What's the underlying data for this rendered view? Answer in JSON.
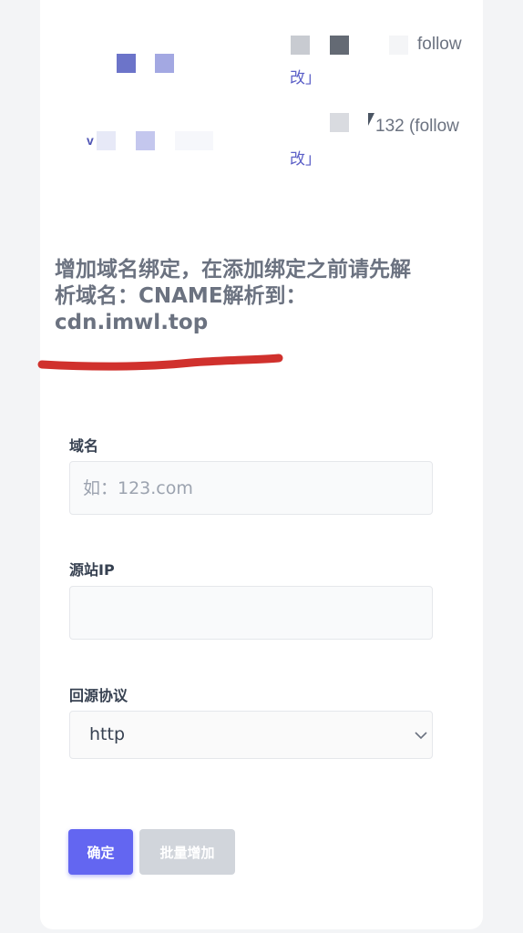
{
  "list": {
    "rows": [
      {
        "follow_text": "follow",
        "suffix_text": "改」"
      },
      {
        "follow_text": "132 (follow",
        "prefix_text": "v",
        "suffix_text": "改」"
      }
    ]
  },
  "form": {
    "title_lines": [
      "增加域名绑定，在添加绑定之前请先解",
      "析域名：CNAME解析到：",
      "cdn.imwl.top"
    ],
    "domain_label": "域名",
    "domain_placeholder": "如：123.com",
    "source_ip_label": "源站IP",
    "source_ip_value": "",
    "protocol_label": "回源协议",
    "protocol_value": "http",
    "submit_label": "确定",
    "batch_label": "批量增加"
  },
  "annotation": {
    "underline_color": "#d0312d"
  },
  "colors": {
    "accent": "#6366f1",
    "disabled": "#d1d5db"
  },
  "icons": {
    "select_arrow": "chevron-down-icon"
  }
}
